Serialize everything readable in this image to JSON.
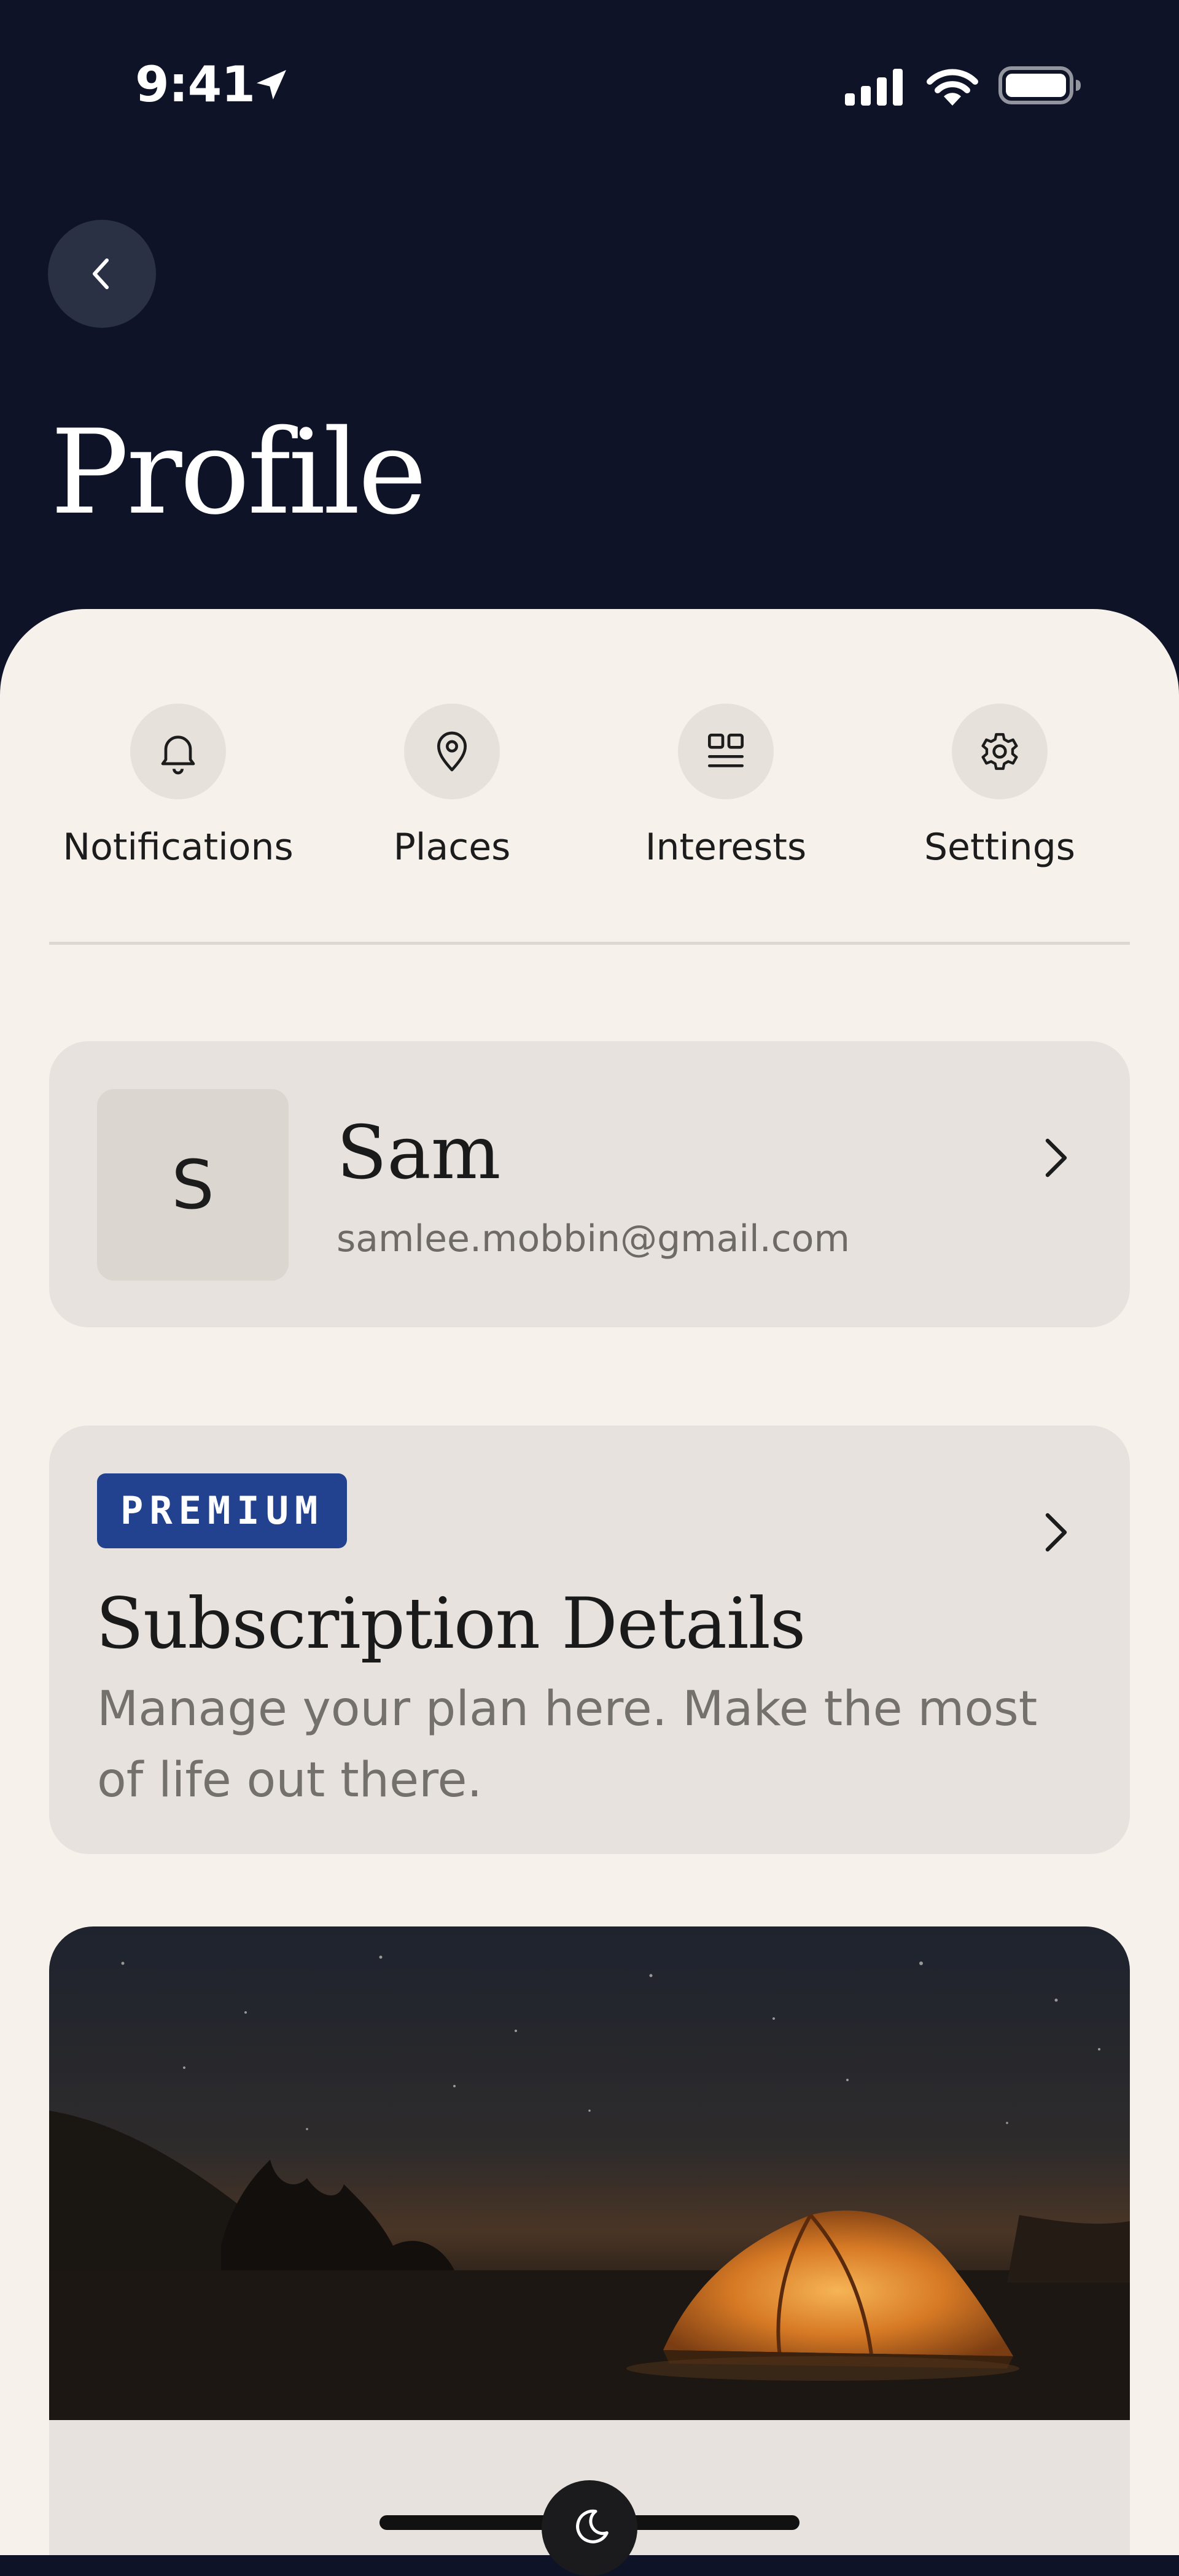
{
  "status_bar": {
    "time": "9:41",
    "icons": [
      "location-arrow-icon",
      "cellular-signal-icon",
      "wifi-icon",
      "battery-icon"
    ]
  },
  "header": {
    "back_icon": "chevron-left-icon",
    "title": "Profile"
  },
  "quick_nav": [
    {
      "label": "Notifications",
      "icon": "bell-icon"
    },
    {
      "label": "Places",
      "icon": "map-pin-icon"
    },
    {
      "label": "Interests",
      "icon": "interests-grid-icon"
    },
    {
      "label": "Settings",
      "icon": "gear-icon"
    }
  ],
  "profile": {
    "initial": "S",
    "name": "Sam",
    "email": "samlee.mobbin@gmail.com"
  },
  "subscription": {
    "badge": "PREMIUM",
    "title": "Subscription Details",
    "description": "Manage your plan here. Make the most of life out there."
  },
  "promo": {
    "image_subject": "tent-under-night-sky"
  },
  "colors": {
    "header_bg": "#0E1328",
    "sheet_bg": "#F6F1EB",
    "card_bg": "#E7E2DD",
    "badge_bg": "#22418F"
  }
}
